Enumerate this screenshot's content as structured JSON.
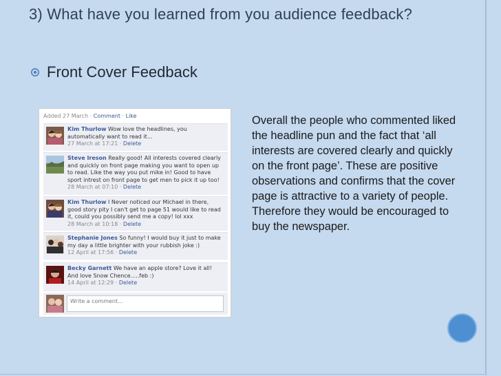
{
  "slide": {
    "title": "3) What have you learned from you audience feedback?",
    "bullet": "Front Cover Feedback",
    "body": "Overall the people who commented liked the headline pun and the fact that ‘all interests are covered clearly and quickly on the front page’. These are positive observations and confirms that the cover page is attractive to a variety of people. Therefore they would be encouraged to buy the newspaper."
  },
  "colors": {
    "background": "#c5d9ef",
    "title": "#2e3f56",
    "bullet": "#4f81bd",
    "circle": "#4d8fd0",
    "fb_link": "#3b5998",
    "fb_comment_bg": "#edeff4"
  },
  "feedback": {
    "meta_prefix": "Added 27 March ·",
    "meta_comment": "Comment",
    "meta_sep": "·",
    "meta_like": "Like",
    "comments": [
      {
        "name": "Kim Thurlow",
        "text": "Wow love the headlines, you automatically want to read it...",
        "time": "27 March at 17:21 ·",
        "action": "Delete",
        "avatar": "photo-two-girls"
      },
      {
        "name": "Steve Ireson",
        "text": "Really good! All interests covered clearly and quickly on front page making you want to open up to read. Like the way you put mike in! Good to have sport intrest on front page to get men to pick it up too!",
        "time": "28 March at 07:10 ·",
        "action": "Delete",
        "avatar": "photo-landscape"
      },
      {
        "name": "Kim Thurlow",
        "text": "I Never noticed our Michael in there, good story pity I can't get to page 51 would like to read it, could you possibly send me a copy! lol xxx",
        "time": "28 March at 10:18 ·",
        "action": "Delete",
        "avatar": "photo-two-girls"
      },
      {
        "name": "Stephanie Jones",
        "text": "So funny! I would buy it just to make my day a little brighter with your rubbish joke :)",
        "time": "12 April at 17:56 ·",
        "action": "Delete",
        "avatar": "photo-group"
      },
      {
        "name": "Becky Garnett",
        "text": "We have an apple store? Love it all! And love Snow Chence.....feb :)",
        "time": "14 April at 12:29 ·",
        "action": "Delete",
        "avatar": "photo-red"
      }
    ],
    "input_placeholder": "Write a comment..."
  }
}
